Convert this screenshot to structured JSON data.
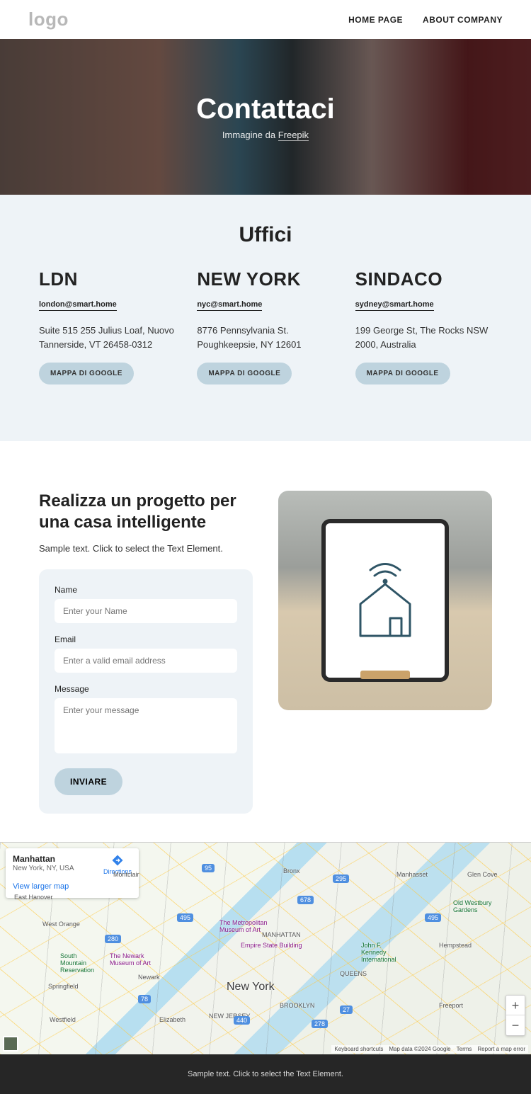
{
  "header": {
    "logo": "logo",
    "nav": [
      "HOME PAGE",
      "ABOUT COMPANY"
    ]
  },
  "hero": {
    "title": "Contattaci",
    "subtitle_prefix": "Immagine da ",
    "subtitle_link": "Freepik"
  },
  "offices": {
    "title": "Uffici",
    "items": [
      {
        "name": "LDN",
        "email": "london@smart.home",
        "address": "Suite 515 255 Julius Loaf, Nuovo Tannerside, VT 26458-0312",
        "button": "MAPPA DI GOOGLE"
      },
      {
        "name": "NEW YORK",
        "email": "nyc@smart.home",
        "address": "8776 Pennsylvania St. Poughkeepsie, NY 12601",
        "button": "MAPPA DI GOOGLE"
      },
      {
        "name": "SINDACO",
        "email": "sydney@smart.home",
        "address": "199 George St, The Rocks NSW 2000, Australia",
        "button": "MAPPA DI GOOGLE"
      }
    ]
  },
  "project": {
    "title": "Realizza un progetto per una casa intelligente",
    "subtext": "Sample text. Click to select the Text Element.",
    "form": {
      "name_label": "Name",
      "name_placeholder": "Enter your Name",
      "email_label": "Email",
      "email_placeholder": "Enter a valid email address",
      "message_label": "Message",
      "message_placeholder": "Enter your message",
      "submit": "INVIARE"
    }
  },
  "map": {
    "card": {
      "title": "Manhattan",
      "subtitle": "New York, NY, USA",
      "view": "View larger map",
      "directions": "Directions"
    },
    "city_label": "New York",
    "zoom_in": "+",
    "zoom_out": "−",
    "attr": {
      "shortcuts": "Keyboard shortcuts",
      "data": "Map data ©2024 Google",
      "terms": "Terms",
      "report": "Report a map error"
    }
  },
  "footer": {
    "text": "Sample text. Click to select the Text Element."
  }
}
